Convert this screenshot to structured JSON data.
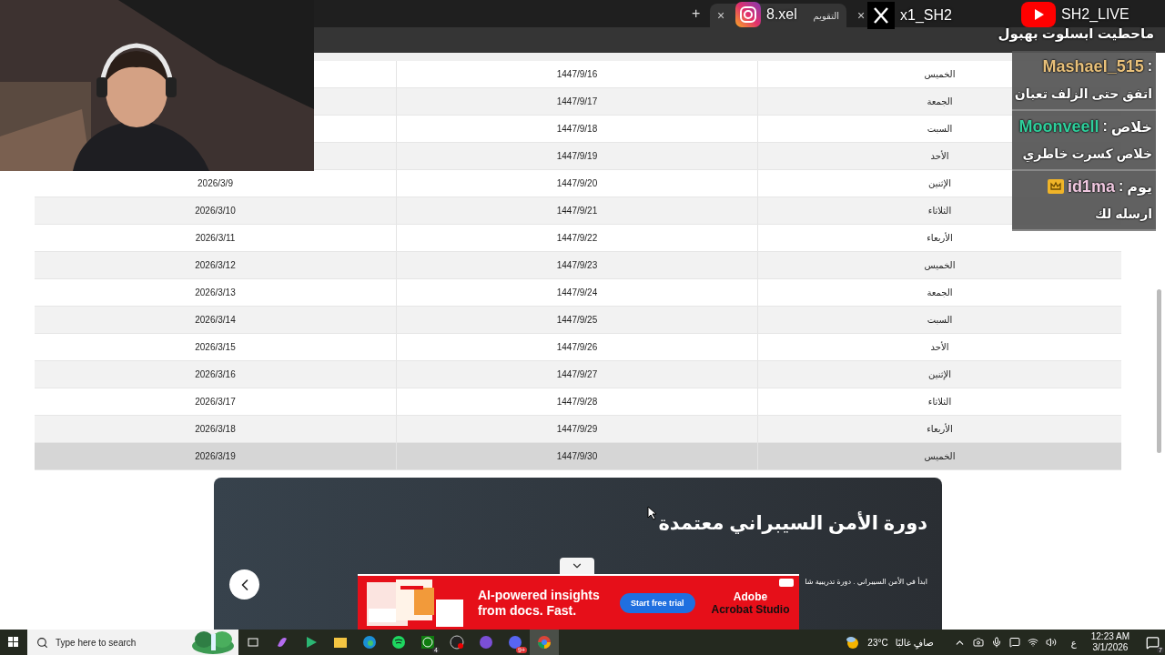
{
  "browser": {
    "new_tab": "+",
    "tab": {
      "title": "التقويم",
      "close": "×"
    },
    "other_tab_close": "×"
  },
  "stream_overlay": {
    "instagram": {
      "handle": "8.xel"
    },
    "x": {
      "handle": "x1_SH2"
    },
    "youtube": {
      "handle": "SH2_LIVE"
    },
    "chat": {
      "top_line": "ماحطيت ابسلوت بهبول",
      "messages": [
        {
          "user": "Mashael_515",
          "color": "#e8c07a",
          "separator": ":",
          "text": "اتفق حتى الزلف تعبان",
          "badge": false
        },
        {
          "user": "Moonveell",
          "color": "#2fcf9c",
          "separator": ":",
          "lead": "خلاص",
          "text": "خلاص كسرت خاطري",
          "badge": false
        },
        {
          "user": "id1ma",
          "color": "#f0c8e0",
          "separator": ":",
          "lead": "يوم",
          "text": "ارسله لك",
          "badge": true
        }
      ]
    }
  },
  "table": {
    "rows": [
      {
        "day": "الخميس",
        "hijri": "1447/9/16",
        "highlighted": false
      },
      {
        "day": "الجمعة",
        "hijri": "1447/9/17",
        "highlighted": false
      },
      {
        "day": "السبت",
        "hijri": "1447/9/18",
        "highlighted": false
      },
      {
        "day": "الأحد",
        "hijri": "1447/9/19",
        "highlighted": false
      },
      {
        "day": "الإثنين",
        "hijri": "1447/9/20",
        "gregorian": "2026/3/9",
        "highlighted": false
      },
      {
        "day": "الثلاثاء",
        "hijri": "1447/9/21",
        "gregorian": "2026/3/10",
        "highlighted": false
      },
      {
        "day": "الأربعاء",
        "hijri": "1447/9/22",
        "gregorian": "2026/3/11",
        "highlighted": false
      },
      {
        "day": "الخميس",
        "hijri": "1447/9/23",
        "gregorian": "2026/3/12",
        "highlighted": false
      },
      {
        "day": "الجمعة",
        "hijri": "1447/9/24",
        "gregorian": "2026/3/13",
        "highlighted": false
      },
      {
        "day": "السبت",
        "hijri": "1447/9/25",
        "gregorian": "2026/3/14",
        "highlighted": false
      },
      {
        "day": "الأحد",
        "hijri": "1447/9/26",
        "gregorian": "2026/3/15",
        "highlighted": false
      },
      {
        "day": "الإثنين",
        "hijri": "1447/9/27",
        "gregorian": "2026/3/16",
        "highlighted": false
      },
      {
        "day": "الثلاثاء",
        "hijri": "1447/9/28",
        "gregorian": "2026/3/17",
        "highlighted": false
      },
      {
        "day": "الأربعاء",
        "hijri": "1447/9/29",
        "gregorian": "2026/3/18",
        "highlighted": false
      },
      {
        "day": "الخميس",
        "hijri": "1447/9/30",
        "gregorian": "2026/3/19",
        "highlighted": true
      }
    ]
  },
  "banner": {
    "title": "دورة الأمن السيبراني معتمدة",
    "subtitle": "ابدأ في الأمن السيبراني . دورة تدريبية شا"
  },
  "ad": {
    "headline": "AI-powered insights from docs. Fast.",
    "cta": "Start free trial",
    "brand": "Adobe",
    "product": "Acrobat Studio"
  },
  "taskbar": {
    "search": {
      "placeholder": "Type here to search"
    },
    "apps": [
      {
        "kind": "taskview"
      },
      {
        "kind": "copilot"
      },
      {
        "kind": "play"
      },
      {
        "kind": "folder"
      },
      {
        "kind": "edge"
      },
      {
        "kind": "spotify"
      },
      {
        "kind": "xbox"
      },
      {
        "kind": "obs"
      },
      {
        "kind": "chat"
      },
      {
        "kind": "discord"
      },
      {
        "kind": "chrome",
        "selected": true
      }
    ],
    "xbox_badge": "4",
    "discord_badge": "9+",
    "weather": {
      "temp": "23°C",
      "condition": "صافٍ غالبًا"
    },
    "language": "ع",
    "time": "12:23 AM",
    "date": "3/1/2026",
    "notifications": "7"
  }
}
